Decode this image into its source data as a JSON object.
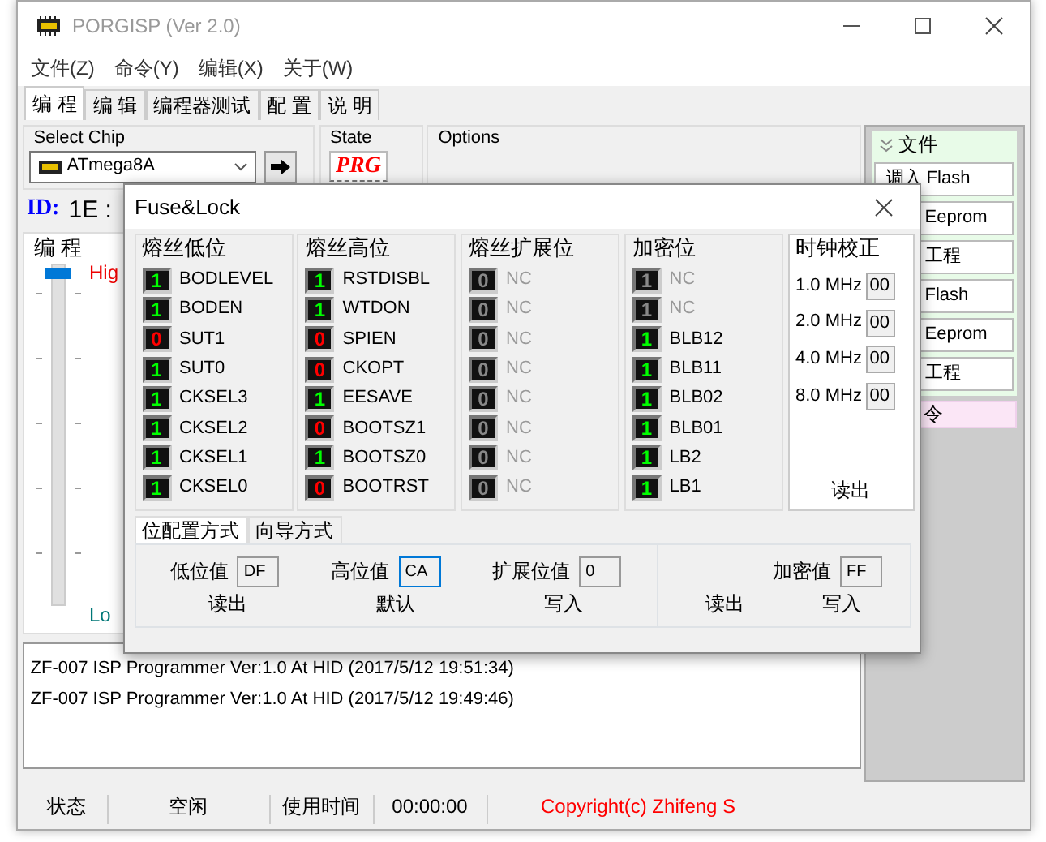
{
  "window": {
    "title": "PORGISP (Ver 2.0)"
  },
  "menu": [
    "文件(Z)",
    "命令(Y)",
    "编辑(X)",
    "关于(W)"
  ],
  "tabs": [
    {
      "label": "编 程",
      "selected": true
    },
    {
      "label": "编 辑",
      "selected": false
    },
    {
      "label": "编程器测试",
      "selected": false
    },
    {
      "label": "配 置",
      "selected": false
    },
    {
      "label": "说 明",
      "selected": false
    }
  ],
  "select_chip": {
    "label": "Select Chip",
    "value": "ATmega8A"
  },
  "state": {
    "label": "State",
    "value": "PRG"
  },
  "options": {
    "label": "Options"
  },
  "chip_id": {
    "label": "ID:",
    "value": "1E :"
  },
  "program_group": {
    "title": "编 程",
    "slider": {
      "level": 1
    },
    "high_label": "Hig",
    "low_label": "Lo"
  },
  "side_panel": {
    "header": "文件",
    "buttons": [
      "调入 Flash",
      "Eeprom",
      "工程",
      "Flash",
      "Eeprom",
      "工程"
    ],
    "footer": "令"
  },
  "log": [
    "ZF-007 ISP Programmer Ver:1.0 At HID (2017/5/12 19:51:34)",
    "ZF-007 ISP Programmer Ver:1.0 At HID (2017/5/12 19:49:46)"
  ],
  "status_bar": {
    "items": [
      "状态",
      "空闲",
      "使用时间",
      "00:00:00"
    ],
    "copyright": "Copyright(c) Zhifeng S"
  },
  "dialog": {
    "title": "Fuse&Lock",
    "bit_groups": [
      {
        "title": "熔丝低位",
        "bits": [
          {
            "value": "1",
            "label": "BODLEVEL",
            "on": true,
            "disabled": false
          },
          {
            "value": "1",
            "label": "BODEN",
            "on": true,
            "disabled": false
          },
          {
            "value": "0",
            "label": "SUT1",
            "on": false,
            "disabled": false
          },
          {
            "value": "1",
            "label": "SUT0",
            "on": true,
            "disabled": false
          },
          {
            "value": "1",
            "label": "CKSEL3",
            "on": true,
            "disabled": false
          },
          {
            "value": "1",
            "label": "CKSEL2",
            "on": true,
            "disabled": false
          },
          {
            "value": "1",
            "label": "CKSEL1",
            "on": true,
            "disabled": false
          },
          {
            "value": "1",
            "label": "CKSEL0",
            "on": true,
            "disabled": false
          }
        ]
      },
      {
        "title": "熔丝高位",
        "bits": [
          {
            "value": "1",
            "label": "RSTDISBL",
            "on": true,
            "disabled": false
          },
          {
            "value": "1",
            "label": "WTDON",
            "on": true,
            "disabled": false
          },
          {
            "value": "0",
            "label": "SPIEN",
            "on": false,
            "disabled": false
          },
          {
            "value": "0",
            "label": "CKOPT",
            "on": false,
            "disabled": false
          },
          {
            "value": "1",
            "label": "EESAVE",
            "on": true,
            "disabled": false
          },
          {
            "value": "0",
            "label": "BOOTSZ1",
            "on": false,
            "disabled": false
          },
          {
            "value": "1",
            "label": "BOOTSZ0",
            "on": true,
            "disabled": false
          },
          {
            "value": "0",
            "label": "BOOTRST",
            "on": false,
            "disabled": false
          }
        ]
      },
      {
        "title": "熔丝扩展位",
        "bits": [
          {
            "value": "0",
            "label": "NC",
            "disabled": true
          },
          {
            "value": "0",
            "label": "NC",
            "disabled": true
          },
          {
            "value": "0",
            "label": "NC",
            "disabled": true
          },
          {
            "value": "0",
            "label": "NC",
            "disabled": true
          },
          {
            "value": "0",
            "label": "NC",
            "disabled": true
          },
          {
            "value": "0",
            "label": "NC",
            "disabled": true
          },
          {
            "value": "0",
            "label": "NC",
            "disabled": true
          },
          {
            "value": "0",
            "label": "NC",
            "disabled": true
          }
        ]
      },
      {
        "title": "加密位",
        "bits": [
          {
            "value": "1",
            "label": "NC",
            "disabled": true
          },
          {
            "value": "1",
            "label": "NC",
            "disabled": true
          },
          {
            "value": "1",
            "label": "BLB12",
            "on": true,
            "disabled": false
          },
          {
            "value": "1",
            "label": "BLB11",
            "on": true,
            "disabled": false
          },
          {
            "value": "1",
            "label": "BLB02",
            "on": true,
            "disabled": false
          },
          {
            "value": "1",
            "label": "BLB01",
            "on": true,
            "disabled": false
          },
          {
            "value": "1",
            "label": "LB2",
            "on": true,
            "disabled": false
          },
          {
            "value": "1",
            "label": "LB1",
            "on": true,
            "disabled": false
          }
        ]
      }
    ],
    "clock": {
      "title": "时钟校正",
      "rows": [
        {
          "label": "1.0 MHz",
          "value": "00"
        },
        {
          "label": "2.0 MHz",
          "value": "00"
        },
        {
          "label": "4.0 MHz",
          "value": "00"
        },
        {
          "label": "8.0 MHz",
          "value": "00"
        }
      ],
      "button": "读出"
    },
    "tabs": [
      {
        "label": "位配置方式",
        "selected": true
      },
      {
        "label": "向导方式",
        "selected": false
      }
    ],
    "values": [
      {
        "label": "低位值",
        "value": "DF",
        "focused": false
      },
      {
        "label": "高位值",
        "value": "CA",
        "focused": true
      },
      {
        "label": "扩展位值",
        "value": "0",
        "focused": false
      }
    ],
    "actions": [
      "读出",
      "默认",
      "写入"
    ],
    "lock": {
      "label": "加密值",
      "value": "FF",
      "focused": false,
      "actions": [
        "读出",
        "写入"
      ]
    }
  }
}
